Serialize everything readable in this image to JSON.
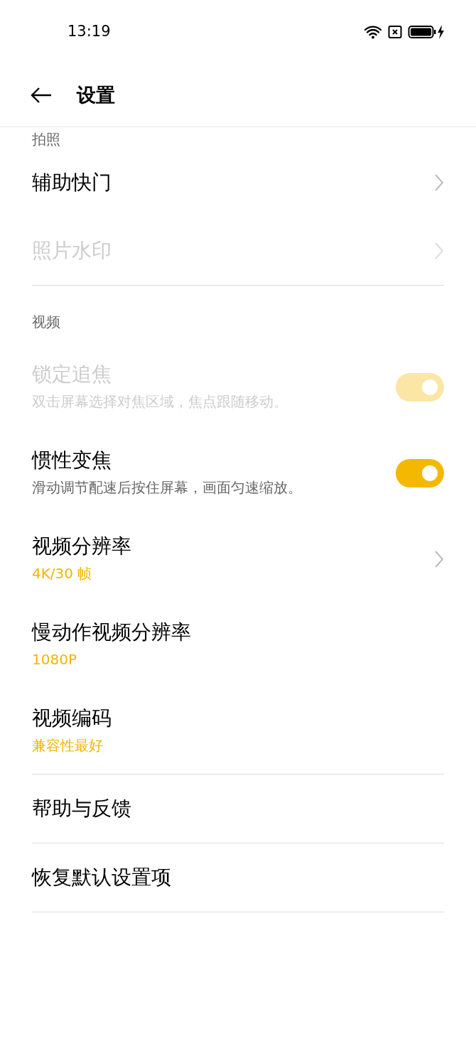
{
  "status_bar": {
    "time": "13:19"
  },
  "app_bar": {
    "title": "设置"
  },
  "sections": [
    {
      "header": "拍照",
      "items": [
        {
          "kind": "link",
          "title": "辅助快门",
          "disabled": false
        },
        {
          "kind": "link",
          "title": "照片水印",
          "disabled": true
        }
      ]
    },
    {
      "header": "视频",
      "items": [
        {
          "kind": "switch",
          "title": "锁定追焦",
          "subtitle": "双击屏幕选择对焦区域，焦点跟随移动。",
          "disabled": true,
          "on": true
        },
        {
          "kind": "switch",
          "title": "惯性变焦",
          "subtitle": "滑动调节配速后按住屏幕，画面匀速缩放。",
          "disabled": false,
          "on": true
        },
        {
          "kind": "link",
          "title": "视频分辨率",
          "value": "4K/30 帧",
          "disabled": false
        },
        {
          "kind": "plain",
          "title": "慢动作视频分辨率",
          "value": "1080P",
          "disabled": false
        },
        {
          "kind": "plain",
          "title": "视频编码",
          "value": "兼容性最好",
          "disabled": false
        }
      ]
    },
    {
      "items": [
        {
          "kind": "plain",
          "title": "帮助与反馈",
          "disabled": false
        }
      ]
    },
    {
      "items": [
        {
          "kind": "plain",
          "title": "恢复默认设置项",
          "disabled": false
        }
      ]
    }
  ]
}
